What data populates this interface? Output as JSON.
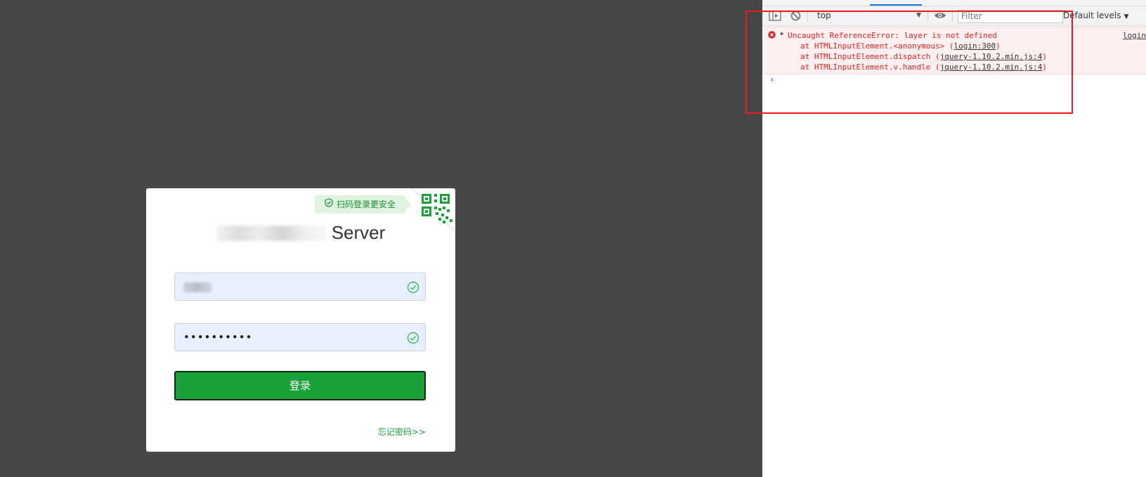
{
  "login": {
    "scan_tip": "扫码登录更安全",
    "title_suffix": "Server",
    "password_value": "••••••••••",
    "login_label": "登录",
    "forgot_label": "忘记密码>>"
  },
  "devtools": {
    "context": "top",
    "filter_placeholder": "Filter",
    "levels_label": "Default levels",
    "error": {
      "message": "Uncaught ReferenceError: layer is not defined",
      "source": "login",
      "stack": [
        {
          "prefix": "at HTMLInputElement.<anonymous> (",
          "link": "login:300",
          "suffix": ")"
        },
        {
          "prefix": "at HTMLInputElement.dispatch (",
          "link": "jquery-1.10.2.min.js:4",
          "suffix": ")"
        },
        {
          "prefix": "at HTMLInputElement.v.handle (",
          "link": "jquery-1.10.2.min.js:4",
          "suffix": ")"
        }
      ]
    },
    "prompt_symbol": "›"
  },
  "colors": {
    "page_background": "#474747",
    "brand_green": "#1aa13a",
    "error_red": "#e02020",
    "highlight_red": "#e81c1c",
    "input_fill": "#e8f0fe"
  },
  "icons": [
    "qr-code-icon",
    "shield-check-icon",
    "check-circle-icon",
    "sidebar-toggle-icon",
    "clear-console-icon",
    "eye-icon",
    "error-icon",
    "expand-triangle-icon"
  ]
}
